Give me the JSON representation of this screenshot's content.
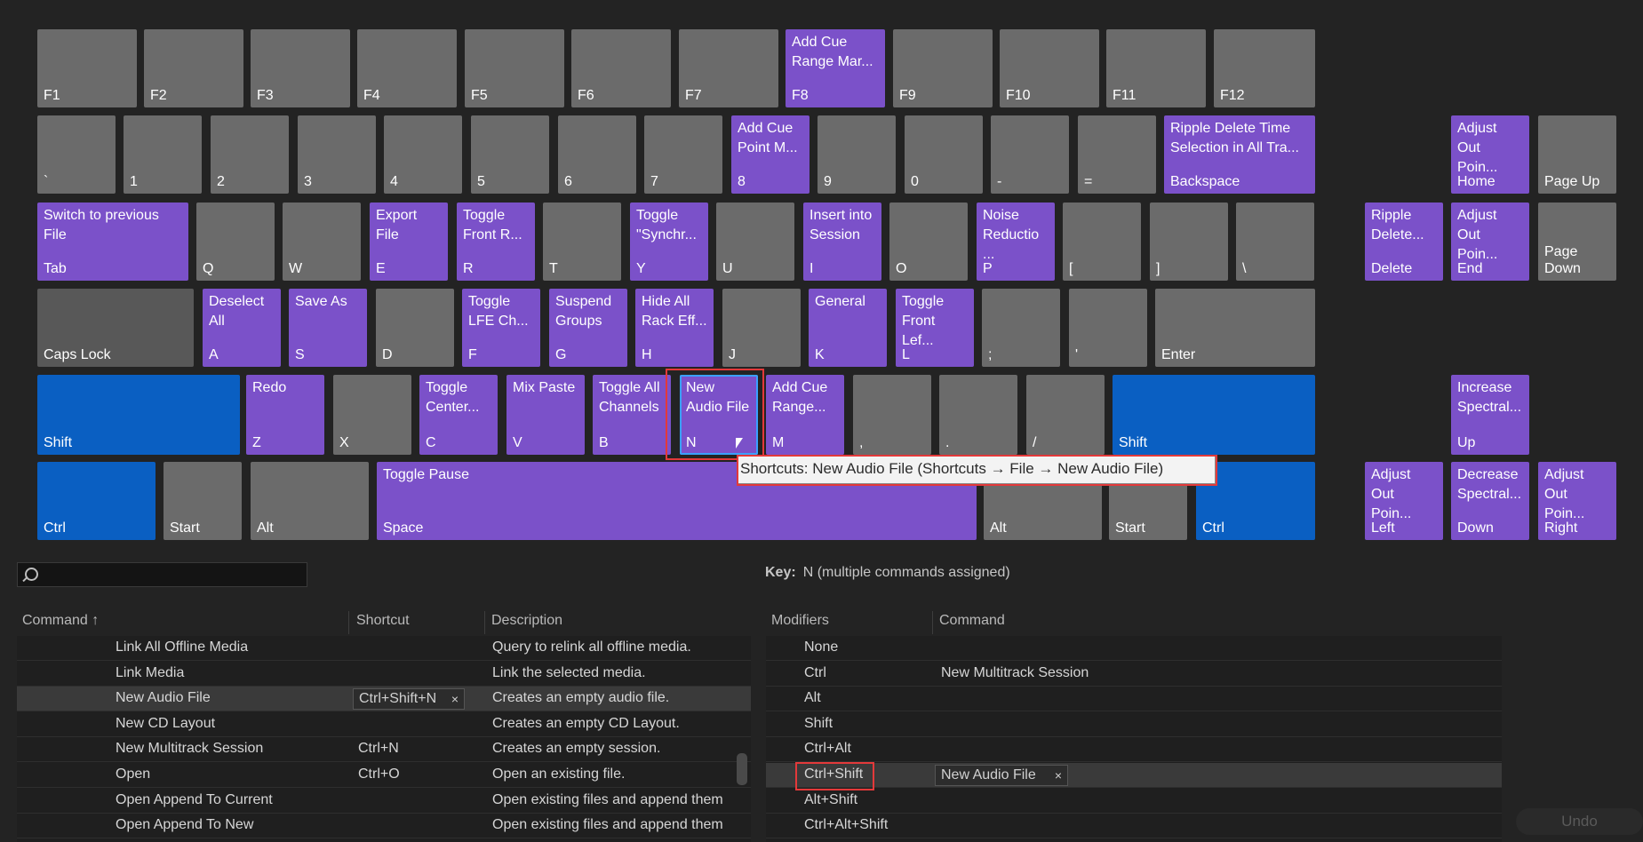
{
  "keyboard": {
    "keys": [
      {
        "id": "F1",
        "label": "F1",
        "cmd": ""
      },
      {
        "id": "F2",
        "label": "F2",
        "cmd": ""
      },
      {
        "id": "F3",
        "label": "F3",
        "cmd": ""
      },
      {
        "id": "F4",
        "label": "F4",
        "cmd": ""
      },
      {
        "id": "F5",
        "label": "F5",
        "cmd": ""
      },
      {
        "id": "F6",
        "label": "F6",
        "cmd": ""
      },
      {
        "id": "F7",
        "label": "F7",
        "cmd": ""
      },
      {
        "id": "F8",
        "label": "F8",
        "cmd": "Add Cue\nRange Mar..."
      },
      {
        "id": "F9",
        "label": "F9",
        "cmd": ""
      },
      {
        "id": "F10",
        "label": "F10",
        "cmd": ""
      },
      {
        "id": "F11",
        "label": "F11",
        "cmd": ""
      },
      {
        "id": "F12",
        "label": "F12",
        "cmd": ""
      },
      {
        "id": "grave",
        "label": "`",
        "cmd": ""
      },
      {
        "id": "k1",
        "label": "1",
        "cmd": ""
      },
      {
        "id": "k2",
        "label": "2",
        "cmd": ""
      },
      {
        "id": "k3",
        "label": "3",
        "cmd": ""
      },
      {
        "id": "k4",
        "label": "4",
        "cmd": ""
      },
      {
        "id": "k5",
        "label": "5",
        "cmd": ""
      },
      {
        "id": "k6",
        "label": "6",
        "cmd": ""
      },
      {
        "id": "k7",
        "label": "7",
        "cmd": ""
      },
      {
        "id": "k8",
        "label": "8",
        "cmd": "Add Cue\nPoint M..."
      },
      {
        "id": "k9",
        "label": "9",
        "cmd": ""
      },
      {
        "id": "k0",
        "label": "0",
        "cmd": ""
      },
      {
        "id": "minus",
        "label": "-",
        "cmd": ""
      },
      {
        "id": "equal",
        "label": "=",
        "cmd": ""
      },
      {
        "id": "backspace",
        "label": "Backspace",
        "cmd": "Ripple Delete Time\nSelection in All Tra..."
      },
      {
        "id": "home",
        "label": "Home",
        "cmd": "Adjust\nOut\nPoin..."
      },
      {
        "id": "pageup",
        "label": "Page Up",
        "cmd": ""
      },
      {
        "id": "tab",
        "label": "Tab",
        "cmd": "Switch to previous\nFile"
      },
      {
        "id": "Q",
        "label": "Q",
        "cmd": ""
      },
      {
        "id": "W",
        "label": "W",
        "cmd": ""
      },
      {
        "id": "E",
        "label": "E",
        "cmd": "Export\nFile"
      },
      {
        "id": "R",
        "label": "R",
        "cmd": "Toggle\nFront R..."
      },
      {
        "id": "T",
        "label": "T",
        "cmd": ""
      },
      {
        "id": "Y",
        "label": "Y",
        "cmd": "Toggle\n\"Synchr..."
      },
      {
        "id": "U",
        "label": "U",
        "cmd": ""
      },
      {
        "id": "I",
        "label": "I",
        "cmd": "Insert into\nSession"
      },
      {
        "id": "O",
        "label": "O",
        "cmd": ""
      },
      {
        "id": "P",
        "label": "P",
        "cmd": "Noise\nReductio\n..."
      },
      {
        "id": "lbracket",
        "label": "[",
        "cmd": ""
      },
      {
        "id": "rbracket",
        "label": "]",
        "cmd": ""
      },
      {
        "id": "backslash",
        "label": "\\",
        "cmd": ""
      },
      {
        "id": "delete",
        "label": "Delete",
        "cmd": "Ripple\nDelete..."
      },
      {
        "id": "end",
        "label": "End",
        "cmd": "Adjust\nOut\nPoin..."
      },
      {
        "id": "pagedown",
        "label": "Page\nDown",
        "cmd": ""
      },
      {
        "id": "capslock",
        "label": "Caps Lock",
        "cmd": ""
      },
      {
        "id": "A",
        "label": "A",
        "cmd": "Deselect\nAll"
      },
      {
        "id": "S",
        "label": "S",
        "cmd": "Save As"
      },
      {
        "id": "D",
        "label": "D",
        "cmd": ""
      },
      {
        "id": "F",
        "label": "F",
        "cmd": "Toggle\nLFE Ch..."
      },
      {
        "id": "G",
        "label": "G",
        "cmd": "Suspend\nGroups"
      },
      {
        "id": "H",
        "label": "H",
        "cmd": "Hide All\nRack Eff..."
      },
      {
        "id": "J",
        "label": "J",
        "cmd": ""
      },
      {
        "id": "K",
        "label": "K",
        "cmd": "General"
      },
      {
        "id": "L",
        "label": "L",
        "cmd": "Toggle\nFront\nLef..."
      },
      {
        "id": "semicolon",
        "label": ";",
        "cmd": ""
      },
      {
        "id": "quote",
        "label": "'",
        "cmd": ""
      },
      {
        "id": "enter",
        "label": "Enter",
        "cmd": ""
      },
      {
        "id": "lshift",
        "label": "Shift",
        "cmd": ""
      },
      {
        "id": "Z",
        "label": "Z",
        "cmd": "Redo"
      },
      {
        "id": "X",
        "label": "X",
        "cmd": ""
      },
      {
        "id": "C",
        "label": "C",
        "cmd": "Toggle\nCenter..."
      },
      {
        "id": "V",
        "label": "V",
        "cmd": "Mix Paste"
      },
      {
        "id": "B",
        "label": "B",
        "cmd": "Toggle All\nChannels"
      },
      {
        "id": "N",
        "label": "N",
        "cmd": "New\nAudio File"
      },
      {
        "id": "M",
        "label": "M",
        "cmd": "Add Cue\nRange..."
      },
      {
        "id": "comma",
        "label": ",",
        "cmd": ""
      },
      {
        "id": "period",
        "label": ".",
        "cmd": ""
      },
      {
        "id": "slash",
        "label": "/",
        "cmd": ""
      },
      {
        "id": "rshift",
        "label": "Shift",
        "cmd": ""
      },
      {
        "id": "up",
        "label": "Up",
        "cmd": "Increase\nSpectral..."
      },
      {
        "id": "lctrl",
        "label": "Ctrl",
        "cmd": ""
      },
      {
        "id": "lstart",
        "label": "Start",
        "cmd": ""
      },
      {
        "id": "lalt",
        "label": "Alt",
        "cmd": ""
      },
      {
        "id": "space",
        "label": "Space",
        "cmd": "Toggle Pause"
      },
      {
        "id": "ralt",
        "label": "Alt",
        "cmd": ""
      },
      {
        "id": "rstart",
        "label": "Start",
        "cmd": ""
      },
      {
        "id": "rctrl",
        "label": "Ctrl",
        "cmd": ""
      },
      {
        "id": "left",
        "label": "Left",
        "cmd": "Adjust\nOut\nPoin..."
      },
      {
        "id": "down",
        "label": "Down",
        "cmd": "Decrease\nSpectral..."
      },
      {
        "id": "right",
        "label": "Right",
        "cmd": "Adjust\nOut\nPoin..."
      }
    ]
  },
  "tooltip": "Shortcuts: New Audio File (Shortcuts → File → New Audio File)",
  "search": {
    "placeholder": ""
  },
  "key_info": {
    "label": "Key:",
    "value": "N (multiple commands assigned)"
  },
  "commands_table": {
    "headers": {
      "command": "Command",
      "sort_icon": "↑",
      "shortcut": "Shortcut",
      "description": "Description"
    },
    "rows": [
      {
        "command": "Link All Offline Media",
        "shortcut": "",
        "description": "Query to relink all offline media."
      },
      {
        "command": "Link Media",
        "shortcut": "",
        "description": "Link the selected media."
      },
      {
        "command": "New Audio File",
        "shortcut": "Ctrl+Shift+N",
        "description": "Creates an empty audio file."
      },
      {
        "command": "New CD Layout",
        "shortcut": "",
        "description": "Creates an empty CD Layout."
      },
      {
        "command": "New Multitrack Session",
        "shortcut": "Ctrl+N",
        "description": "Creates an empty session."
      },
      {
        "command": "Open",
        "shortcut": "Ctrl+O",
        "description": "Open an existing file."
      },
      {
        "command": "Open Append To Current",
        "shortcut": "",
        "description": "Open existing files and append them"
      },
      {
        "command": "Open Append To New",
        "shortcut": "",
        "description": "Open existing files and append them"
      }
    ]
  },
  "modifiers_table": {
    "headers": {
      "modifiers": "Modifiers",
      "command": "Command"
    },
    "rows": [
      {
        "modifier": "None",
        "command": ""
      },
      {
        "modifier": "Ctrl",
        "command": "New Multitrack Session"
      },
      {
        "modifier": "Alt",
        "command": ""
      },
      {
        "modifier": "Shift",
        "command": ""
      },
      {
        "modifier": "Ctrl+Alt",
        "command": ""
      },
      {
        "modifier": "Ctrl+Shift",
        "command": "New Audio File"
      },
      {
        "modifier": "Alt+Shift",
        "command": ""
      },
      {
        "modifier": "Ctrl+Alt+Shift",
        "command": ""
      }
    ]
  },
  "undo_label": "Undo",
  "colors": {
    "command_key": "#7b51c9",
    "modifier_key": "#0a5fc2",
    "plain_key": "#6b6b6b",
    "highlight": "#e3393a"
  }
}
